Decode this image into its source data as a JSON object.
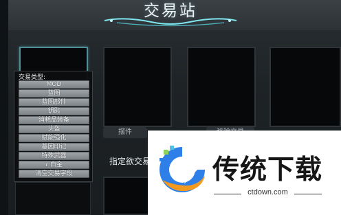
{
  "header": {
    "title": "交易站"
  },
  "slots": {
    "label_1": "摆件",
    "label_2": "移除交易"
  },
  "prompt": {
    "text": "指定欲交易"
  },
  "menu": {
    "header": "交易类型:",
    "items": [
      {
        "label": "MOD"
      },
      {
        "label": "蓝图"
      },
      {
        "label": "蓝图部件"
      },
      {
        "label": "钥匙"
      },
      {
        "label": "消耗品装备"
      },
      {
        "label": "头盔"
      },
      {
        "label": "赋能强化"
      },
      {
        "label": "基因印记"
      },
      {
        "label": "特殊武器"
      },
      {
        "label": "白金"
      },
      {
        "label": "清空交易字段"
      }
    ]
  },
  "watermark": {
    "brand": "传统下载",
    "url": "ctdown.com"
  },
  "colors": {
    "accent": "#4f8f96",
    "menu_item": "#8f9599"
  },
  "icons": {
    "platinum": "platinum-icon"
  }
}
